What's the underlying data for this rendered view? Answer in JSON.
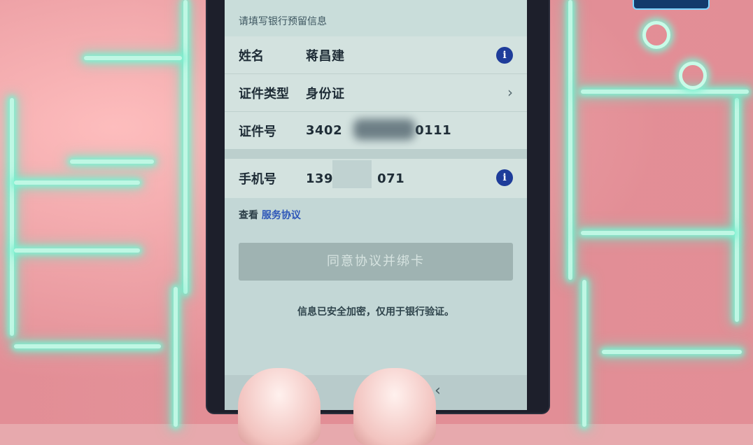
{
  "screen": {
    "header": "请填写银行预留信息",
    "rows": [
      {
        "label": "姓名",
        "value": "蒋昌建",
        "icon": "info-icon"
      },
      {
        "label": "证件类型",
        "value": "身份证",
        "icon": "chevron-right-icon"
      },
      {
        "label": "证件号",
        "value": "3402",
        "value_tail": "0111"
      }
    ],
    "phone_row": {
      "label": "手机号",
      "value": "1391",
      "value_tail": "071",
      "icon": "info-icon"
    },
    "agreement": {
      "prefix": "查看",
      "link": "服务协议"
    },
    "submit_button": "同意协议并绑卡",
    "tip": "信息已安全加密，仅用于银行验证。",
    "nav": {
      "menu_glyph": "≡",
      "back_glyph": "‹"
    }
  },
  "colors": {
    "info_icon": "#1e3c9a",
    "link": "#2c55b8",
    "neon": "#7ff2d2"
  }
}
